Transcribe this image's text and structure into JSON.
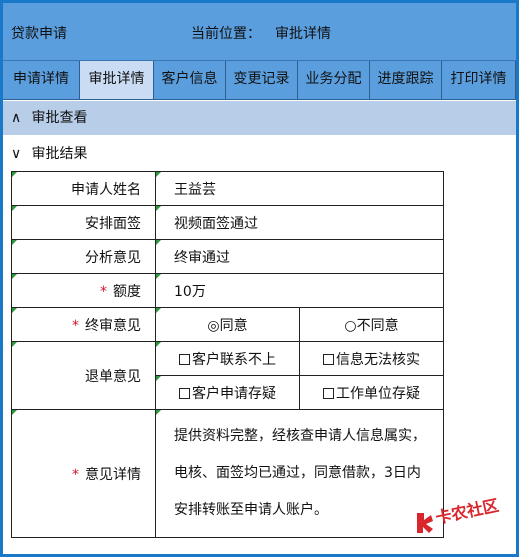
{
  "header": {
    "app_title": "贷款申请",
    "location_label": "当前位置：",
    "location_value": "审批详情"
  },
  "tabs": [
    {
      "label": "申请详情"
    },
    {
      "label": "审批详情"
    },
    {
      "label": "客户信息"
    },
    {
      "label": "变更记录"
    },
    {
      "label": "业务分配"
    },
    {
      "label": "进度跟踪"
    },
    {
      "label": "打印详情"
    }
  ],
  "active_tab": "审批详情",
  "sections": {
    "view": {
      "chevron": "∧",
      "label": "审批查看"
    },
    "result": {
      "chevron": "∨",
      "label": "审批结果"
    }
  },
  "form": {
    "required_mark": "*",
    "name_label": "申请人姓名",
    "name_value": "王益芸",
    "interview_label": "安排面签",
    "interview_value": "视频面签通过",
    "analysis_label": "分析意见",
    "analysis_value": "终审通过",
    "amount_label": "额度",
    "amount_value": "10万",
    "final_label": "终审意见",
    "final_options": [
      "◎同意",
      "○不同意"
    ],
    "final_selected": "同意",
    "reject_label": "退单意见",
    "reject_options": [
      "客户联系不上",
      "信息无法核实",
      "客户申请存疑",
      "工作单位存疑"
    ],
    "detail_label": "意见详情",
    "detail_lines": [
      "提供资料完整，经核查申请人信息属实，",
      "电核、面签均已通过，同意借款，3日内",
      "安排转账至申请人账户。"
    ]
  },
  "colors": {
    "frame_border": "#1a78c8",
    "header_bg": "#5b9ede",
    "active_tab_bg": "#c9dcf3",
    "section_bg": "#b7cde8",
    "required_mark": "#d0142c",
    "cell_marker": "#2a9a3a"
  },
  "watermark": {
    "text": "卡农社区",
    "icon": "kanong-logo-icon"
  }
}
